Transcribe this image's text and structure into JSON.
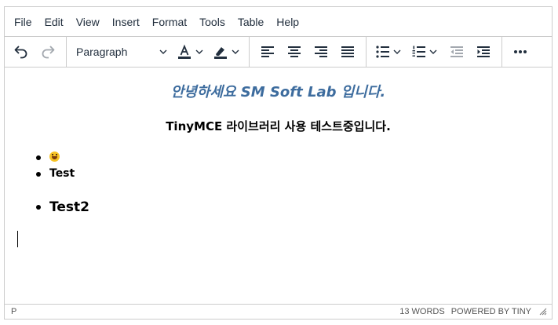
{
  "menubar": [
    "File",
    "Edit",
    "View",
    "Insert",
    "Format",
    "Tools",
    "Table",
    "Help"
  ],
  "toolbar": {
    "block_format": "Paragraph",
    "text_color_letter": "A",
    "icons": [
      "undo-icon",
      "redo-icon",
      "text-color-icon",
      "highlight-icon",
      "align-left-icon",
      "align-center-icon",
      "align-right-icon",
      "align-justify-icon",
      "bullet-list-icon",
      "numbered-list-icon",
      "outdent-icon",
      "indent-icon",
      "more-icon"
    ],
    "colors": {
      "text_color": "#222f3e",
      "disabled": "#a3a8af"
    }
  },
  "content": {
    "heading": "안녕하세요 SM Soft Lab  입니다.",
    "subheading": "TinyMCE 라이브러리 사용 테스트중입니다.",
    "list1": [
      "",
      "Test"
    ],
    "list2": [
      "Test2"
    ],
    "colors": {
      "heading": "#3d6c9e"
    }
  },
  "statusbar": {
    "path": "P",
    "word_count": "13 WORDS",
    "powered_by": "POWERED BY TINY"
  }
}
